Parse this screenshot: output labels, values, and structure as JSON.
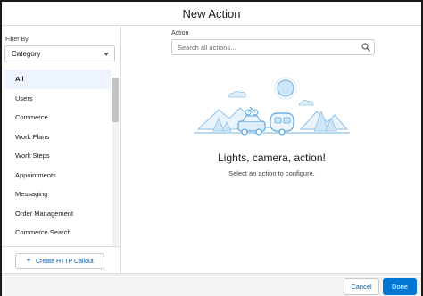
{
  "header": {
    "title": "New Action"
  },
  "sidebar": {
    "filter_label": "Filter By",
    "filter_value": "Category",
    "items": [
      {
        "label": "All",
        "active": true
      },
      {
        "label": "Users"
      },
      {
        "label": "Commerce"
      },
      {
        "label": "Work Plans"
      },
      {
        "label": "Work Steps"
      },
      {
        "label": "Appointments"
      },
      {
        "label": "Messaging"
      },
      {
        "label": "Order Management"
      },
      {
        "label": "Commerce Search"
      }
    ],
    "create_button_label": "Create HTTP Callout",
    "create_button_icon": "plus-icon"
  },
  "main": {
    "action_label": "Action",
    "search_placeholder": "Search all actions...",
    "search_value": "",
    "search_icon": "search-icon",
    "empty_state": {
      "title": "Lights, camera, action!",
      "subtitle": "Select an action to configure."
    }
  },
  "footer": {
    "cancel_label": "Cancel",
    "done_label": "Done"
  },
  "colors": {
    "brand": "#0176d3",
    "link": "#0b5cab",
    "active_item_bg": "#eef4ff",
    "illustration": "#8ec1e8"
  }
}
